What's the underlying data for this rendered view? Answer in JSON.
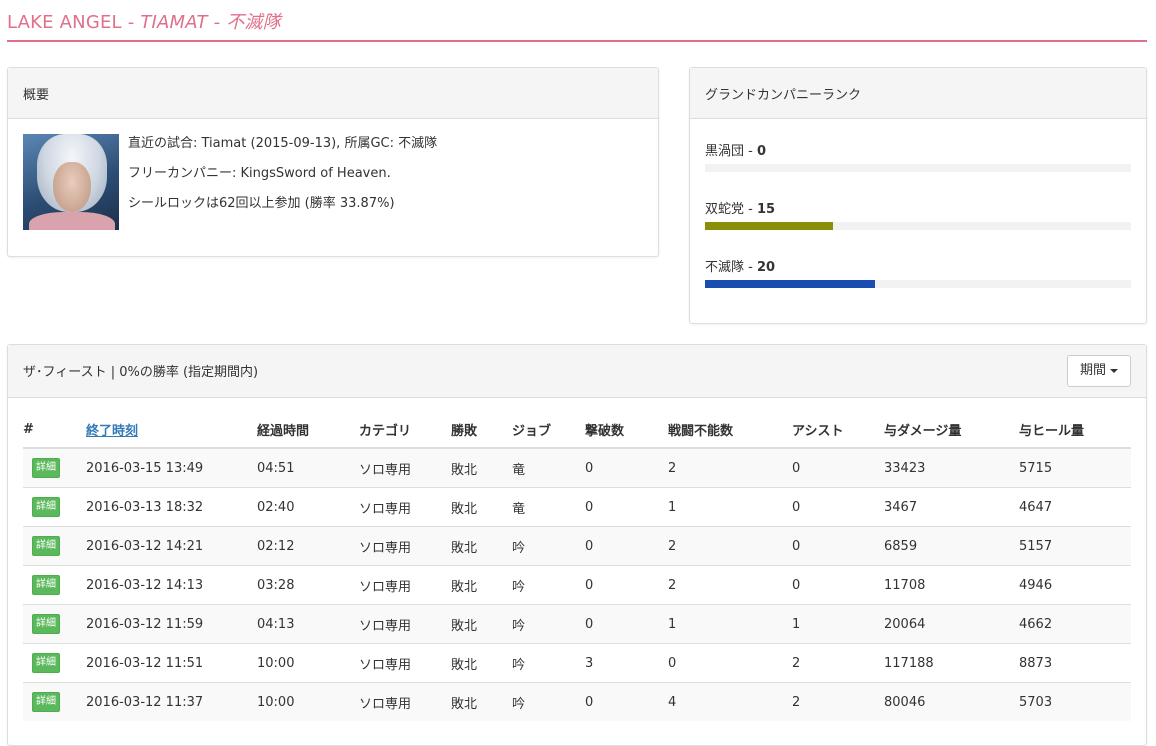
{
  "header": {
    "name": "LAKE ANGEL - ",
    "sub": "TIAMAT - 不滅隊",
    "color": "#e0708a"
  },
  "overview": {
    "title": "概要",
    "latest_match": "直近の試合: Tiamat (2015-09-13), 所属GC: 不滅隊",
    "free_company": "フリーカンパニー: KingsSword of Heaven.",
    "seal_rock": "シールロックは62回以上参加 (勝率 33.87%)"
  },
  "gc_rank": {
    "title": "グランドカンパニーランク",
    "items": [
      {
        "name": "黒渦団",
        "rank": "0",
        "fill": 0.0,
        "color": "#cccccc"
      },
      {
        "name": "双蛇党",
        "rank": "15",
        "fill": 0.3,
        "color": "#8a8f0a"
      },
      {
        "name": "不滅隊",
        "rank": "20",
        "fill": 0.4,
        "color": "#1a4db0"
      }
    ]
  },
  "feast": {
    "title": "ザ･フィースト | 0%の勝率 (指定期間内)",
    "period_label": "期間",
    "detail_label": "詳細",
    "columns": [
      "#",
      "終了時刻",
      "経過時間",
      "カテゴリ",
      "勝敗",
      "ジョブ",
      "撃破数",
      "戦闘不能数",
      "アシスト",
      "与ダメージ量",
      "与ヒール量"
    ],
    "rows": [
      [
        "2016-03-15 13:49",
        "04:51",
        "ソロ専用",
        "敗北",
        "竜",
        "0",
        "2",
        "0",
        "33423",
        "5715"
      ],
      [
        "2016-03-13 18:32",
        "02:40",
        "ソロ専用",
        "敗北",
        "竜",
        "0",
        "1",
        "0",
        "3467",
        "4647"
      ],
      [
        "2016-03-12 14:21",
        "02:12",
        "ソロ専用",
        "敗北",
        "吟",
        "0",
        "2",
        "0",
        "6859",
        "5157"
      ],
      [
        "2016-03-12 14:13",
        "03:28",
        "ソロ専用",
        "敗北",
        "吟",
        "0",
        "2",
        "0",
        "11708",
        "4946"
      ],
      [
        "2016-03-12 11:59",
        "04:13",
        "ソロ専用",
        "敗北",
        "吟",
        "0",
        "1",
        "1",
        "20064",
        "4662"
      ],
      [
        "2016-03-12 11:51",
        "10:00",
        "ソロ専用",
        "敗北",
        "吟",
        "3",
        "0",
        "2",
        "117188",
        "8873"
      ],
      [
        "2016-03-12 11:37",
        "10:00",
        "ソロ専用",
        "敗北",
        "吟",
        "0",
        "4",
        "2",
        "80046",
        "5703"
      ]
    ]
  }
}
